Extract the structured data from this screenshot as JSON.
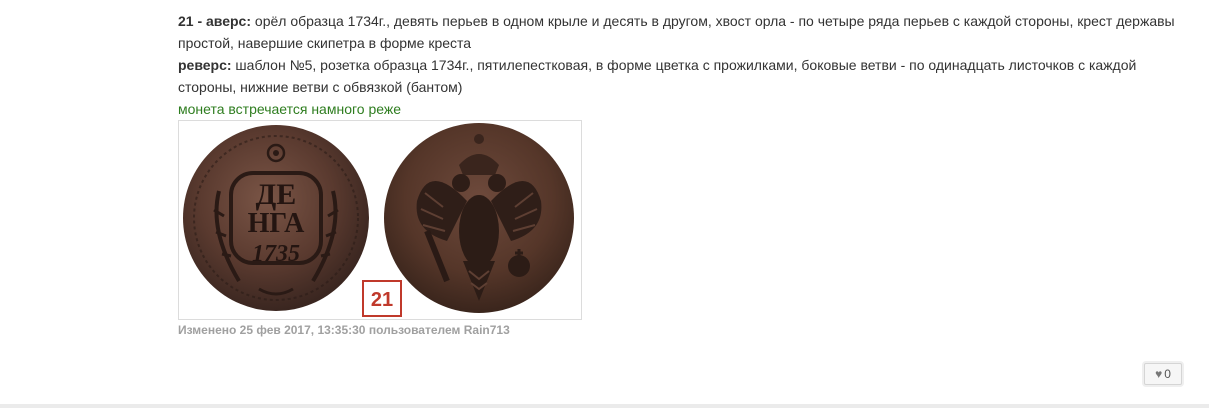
{
  "separator": "--------------------------------------------------------------------------",
  "obverse": {
    "label": "21 - аверс:",
    "text": " орёл образца 1734г., девять перьев в одном крыле и десять в другом, хвост орла - по четыре ряда перьев с каждой стороны, крест державы простой, навершие скипетра в форме креста"
  },
  "reverse": {
    "label": "реверс:",
    "text": " шаблон №5, розетка образца 1734г., пятилепестковая, в форме цветка с прожилками, боковые ветви - по одинадцать листочков с каждой стороны, нижние ветви с обвязкой (бантом)"
  },
  "rarity_note": "монета встречается намного реже",
  "coin_image": {
    "badge": "21",
    "coin_left_legend": [
      "ДЕ",
      "НГА",
      "1735"
    ],
    "colors": {
      "badge": "#c0392b",
      "coin_dark": "#3a2620",
      "coin_mid": "#6e4a3c"
    }
  },
  "edit_info": "Изменено 25 фев 2017, 13:35:30 пользователем Rain713",
  "like": {
    "icon": "heart-icon",
    "count": "0"
  }
}
